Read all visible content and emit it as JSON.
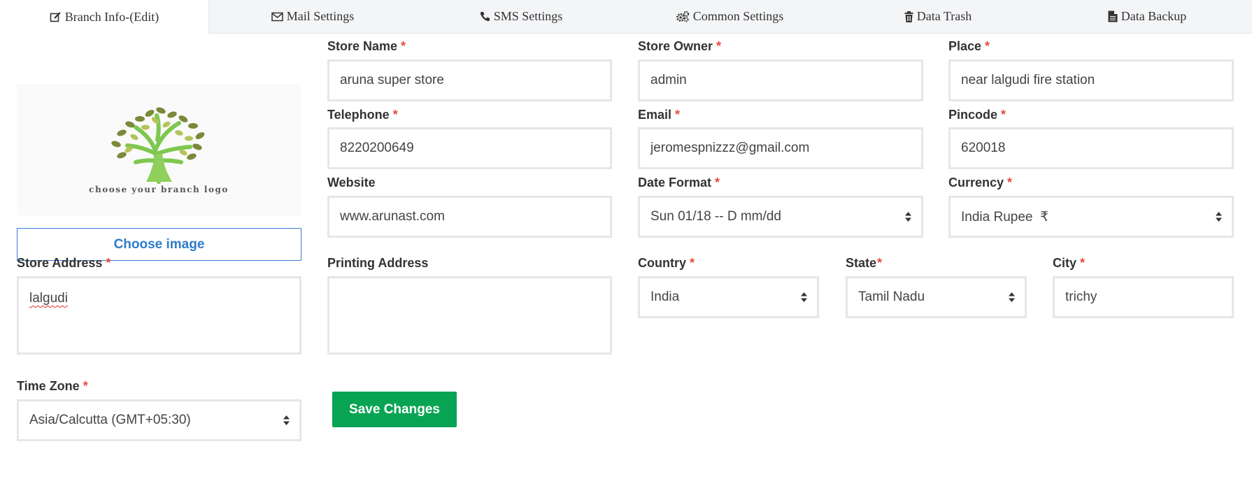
{
  "tabs": [
    {
      "label": "Branch Info-(Edit)",
      "icon": "edit-icon"
    },
    {
      "label": "Mail Settings",
      "icon": "envelope-icon"
    },
    {
      "label": "SMS Settings",
      "icon": "phone-icon"
    },
    {
      "label": "Common Settings",
      "icon": "gears-icon"
    },
    {
      "label": "Data Trash",
      "icon": "trash-icon"
    },
    {
      "label": "Data Backup",
      "icon": "file-icon"
    }
  ],
  "logo": {
    "caption": "choose your branch logo"
  },
  "choose_image_label": "Choose image",
  "required_mark": "*",
  "fields": {
    "store_name": {
      "label": "Store Name",
      "value": "aruna super store"
    },
    "store_owner": {
      "label": "Store Owner",
      "value": "admin"
    },
    "place": {
      "label": "Place",
      "value": "near lalgudi fire station"
    },
    "telephone": {
      "label": "Telephone",
      "value": "8220200649"
    },
    "email": {
      "label": "Email",
      "value": "jeromespnizzz@gmail.com"
    },
    "pincode": {
      "label": "Pincode",
      "value": "620018"
    },
    "website": {
      "label": "Website",
      "value": "www.arunast.com"
    },
    "date_format": {
      "label": "Date Format",
      "value": "Sun 01/18 -- D mm/dd"
    },
    "currency": {
      "label": "Currency",
      "value": "India Rupee  ₹"
    },
    "store_address": {
      "label": "Store Address",
      "value": "lalgudi"
    },
    "printing_address": {
      "label": "Printing Address",
      "value": ""
    },
    "country": {
      "label": "Country",
      "value": "India"
    },
    "state": {
      "label": "State",
      "value": "Tamil Nadu"
    },
    "city": {
      "label": "City",
      "value": "trichy"
    },
    "time_zone": {
      "label": "Time Zone",
      "value": "Asia/Calcutta (GMT+05:30)"
    }
  },
  "save_button_label": "Save Changes",
  "colors": {
    "accent": "#08a454",
    "link": "#2f7bc8",
    "required": "#e74c3c"
  }
}
